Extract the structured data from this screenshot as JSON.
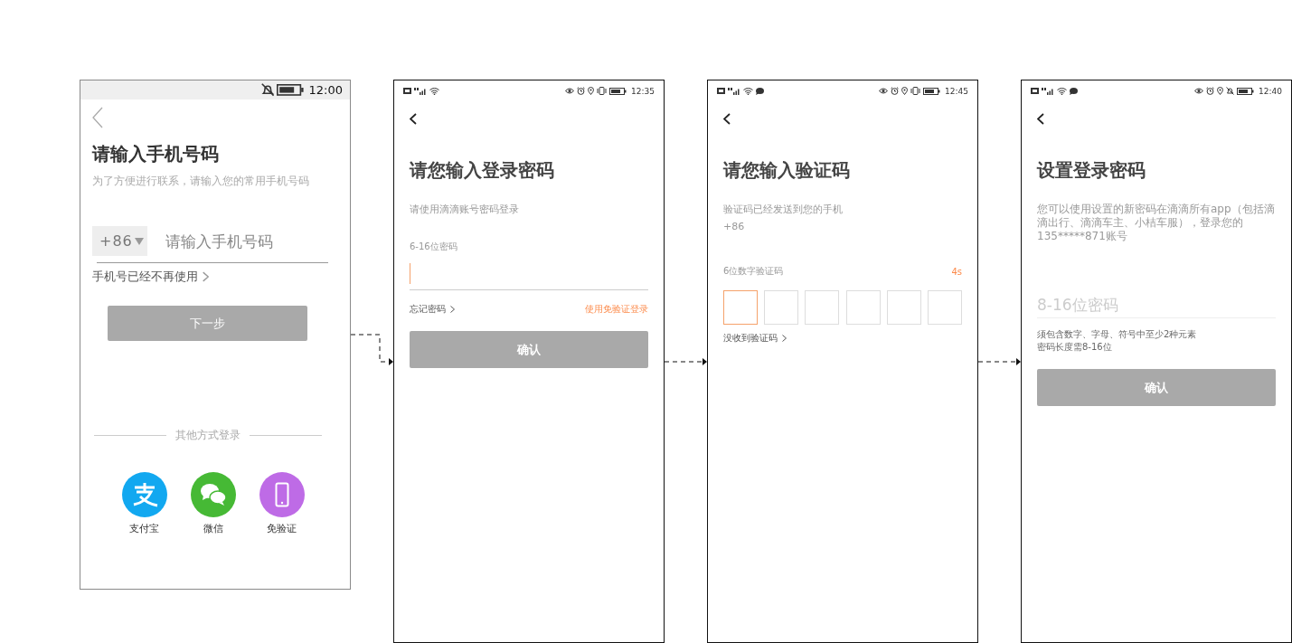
{
  "screens": [
    {
      "kind": "phone-entry",
      "status_bar": {
        "time": "12:00"
      },
      "title": "请输入手机号码",
      "subtitle": "为了方便进行联系，请输入您的常用手机号码",
      "country_code": "+86",
      "phone_placeholder": "请输入手机号码",
      "link": "手机号已经不再使用",
      "button": {
        "label": "下一步",
        "disabled": true
      },
      "divider_label": "其他方式登录",
      "options": [
        {
          "kind": "alipay",
          "label": "支付宝",
          "color": "#12a8f0"
        },
        {
          "kind": "wechat",
          "label": "微信",
          "color": "#46b935"
        },
        {
          "kind": "phone",
          "label": "免验证",
          "color": "#be6be6"
        }
      ]
    },
    {
      "kind": "password-login",
      "status_bar": {
        "time": "12:35"
      },
      "title": "请您输入登录密码",
      "subtitle": "请使用滴滴账号密码登录",
      "field": {
        "label": "6-16位密码",
        "focused": true
      },
      "link_left": "忘记密码",
      "link_right": "使用免验证登录",
      "button": {
        "label": "确认",
        "disabled": true
      }
    },
    {
      "kind": "code-entry",
      "status_bar": {
        "time": "12:45"
      },
      "title": "请您输入验证码",
      "subtitle": "验证码已经发送到您的手机",
      "phone": "+86",
      "field_label": "6位数字验证码",
      "countdown": "4s",
      "code_boxes": [
        {
          "selected": true
        },
        {
          "selected": false
        },
        {
          "selected": false
        },
        {
          "selected": false
        },
        {
          "selected": false
        },
        {
          "selected": false
        }
      ],
      "link": "没收到验证码"
    },
    {
      "kind": "set-password",
      "status_bar": {
        "time": "12:40"
      },
      "title": "设置登录密码",
      "description": "您可以使用设置的新密码在滴滴所有app（包括滴滴出行、滴滴车主、小桔车服），登录您的135*****871账号",
      "placeholder": "8-16位密码",
      "hints": [
        "须包含数字、字母、符号中至少2种元素",
        "密码长度需8-16位"
      ],
      "button": {
        "label": "确认",
        "disabled": true
      }
    }
  ]
}
